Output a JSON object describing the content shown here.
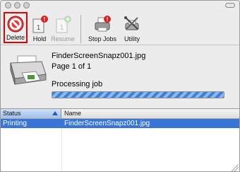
{
  "toolbar": {
    "delete_label": "Delete",
    "hold_label": "Hold",
    "resume_label": "Resume",
    "stop_jobs_label": "Stop Jobs",
    "utility_label": "Utility",
    "icons": {
      "delete": "delete-icon",
      "hold": "hold-icon",
      "resume": "resume-icon",
      "stop_jobs": "printer-stop-icon",
      "utility": "utility-icon"
    },
    "badge_color": "#d62222",
    "highlight_color": "#e60000"
  },
  "job": {
    "name": "FinderScreenSnapz001.jpg",
    "pages": "Page 1 of 1",
    "status": "Processing job",
    "progress_percent": 100
  },
  "table": {
    "columns": [
      "Status",
      "Name"
    ],
    "rows": [
      {
        "status": "Printing",
        "name": "FinderScreenSnapz001.jpg",
        "selected": true
      }
    ],
    "selection_color": "#3875d7"
  }
}
